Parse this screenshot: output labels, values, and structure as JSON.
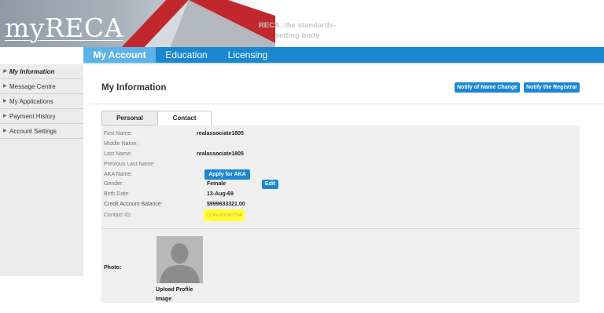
{
  "header": {
    "logo": "myRECA",
    "tagline": "RECA: the standards-setting body"
  },
  "nav": {
    "tabs": [
      {
        "label": "My Account",
        "active": true
      },
      {
        "label": "Education",
        "active": false
      },
      {
        "label": "Licensing",
        "active": false
      }
    ]
  },
  "sidebar": {
    "items": [
      {
        "label": "My Information",
        "active": true
      },
      {
        "label": "Message Centre",
        "active": false
      },
      {
        "label": "My Applications",
        "active": false
      },
      {
        "label": "Payment History",
        "active": false
      },
      {
        "label": "Account Settings",
        "active": false
      }
    ]
  },
  "main": {
    "title": "My Information",
    "buttons": {
      "notify_name_change": "Notify of Name Change",
      "notify_registrar": "Notify the Registrar",
      "apply_aka": "Apply for AKA",
      "edit": "Edit"
    },
    "tabs": {
      "personal": "Personal",
      "contact": "Contact"
    },
    "fields": {
      "first_name": {
        "label": "First Name:",
        "value": "realassociate1805"
      },
      "middle_name": {
        "label": "Middle Name:",
        "value": ""
      },
      "last_name": {
        "label": "Last Name:",
        "value": "realassociate1805"
      },
      "previous_last_name": {
        "label": "Previous Last Name:",
        "value": ""
      },
      "aka_name": {
        "label": "AKA Name:",
        "value": ""
      },
      "gender": {
        "label": "Gender:",
        "value": "Female"
      },
      "birth_date": {
        "label": "Birth Date:",
        "value": "13-Aug-69"
      },
      "credit_balance": {
        "label": "Credit Account Balance:",
        "value": "$999633321.00"
      },
      "contact_id": {
        "label": "Contact ID:",
        "value": "CON-00080704"
      }
    },
    "photo": {
      "label": "Photo:",
      "upload_label": "Upload Profile Image"
    }
  },
  "colors": {
    "nav_blue": "#1a87d0",
    "nav_active": "#5cb3e8",
    "highlight": "#ffff33",
    "roof_red": "#c0282d"
  }
}
